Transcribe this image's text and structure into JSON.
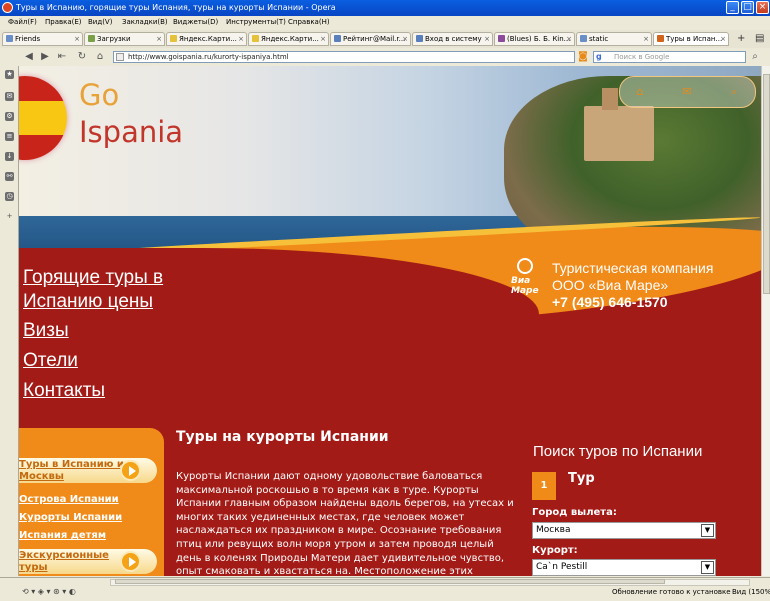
{
  "window": {
    "title": "Туры в Испанию, горящие туры Испания, туры на курорты Испании - Opera"
  },
  "menu": [
    "Файл(F)",
    "Правка(E)",
    "Вид(V)",
    "Закладки(B)",
    "Виджеты(D)",
    "Инструменты(T)",
    "Справка(H)"
  ],
  "tabs": [
    {
      "label": "Friends",
      "color": "#6a8fc8"
    },
    {
      "label": "Загрузки",
      "color": "#7aa14a"
    },
    {
      "label": "Яндекс.Карти...",
      "color": "#e6c23a"
    },
    {
      "label": "Яндекс.Карти...",
      "color": "#e6c23a"
    },
    {
      "label": "Рейтинг@Mail.r...",
      "color": "#5a7fbd"
    },
    {
      "label": "Вход в систему",
      "color": "#5a7fbd"
    },
    {
      "label": "(Blues) Б. Б. Кin...",
      "color": "#8b4a9a"
    },
    {
      "label": "static",
      "color": "#6a8fc8"
    },
    {
      "label": "Туры в Испан...",
      "color": "#d2641c"
    }
  ],
  "address": {
    "url": "http://www.goispania.ru/kurorty-ispaniya.html",
    "search_placeholder": "Поиск в Google"
  },
  "statusbar": {
    "text": "Обновление готово к установке",
    "zoom": "Вид (150%)"
  },
  "site": {
    "logo_go": "Go",
    "logo_ispania": "Ispania",
    "company_logo": "Виа Маре",
    "company_line1": "Туристическая компания",
    "company_line2": "ООО «Виа Маре»",
    "company_phone": "+7 (495) 646-1570",
    "nav": [
      "Горящие туры в",
      "Испанию цены",
      "Визы",
      "Отели",
      "Контакты"
    ],
    "side_btn1": "Туры в Испанию из",
    "side_btn1b": "Москвы",
    "side_links": [
      "Острова Испании",
      "Курорты Испании",
      "Испания детям"
    ],
    "side_btn2": "Экскурсионные",
    "side_btn2b": "туры",
    "main_title": "Туры на курорты Испании",
    "main_text": "Курорты Испании дают одному удовольствие баловаться максимальной роскошью в то время как в туре. Курорты Испании главным образом найдены вдоль берегов, на утесах и многих таких уединенных местах, где человек может наслаждаться их праздником в мире. Осознание требования птиц или ревущих волн моря утром и затем проводя целый день в коленях Природы Матери дает удивительное чувство, опыт смаковать и хвастаться на. Местоположение этих курортов в красивых местах",
    "search_title": "Поиск туров по Испании",
    "step_number": "1",
    "step_label": "Тур",
    "city_label": "Город вылета:",
    "city_value": "Москва",
    "resort_label": "Курорт:",
    "resort_value": "Ca`n Pestill"
  }
}
